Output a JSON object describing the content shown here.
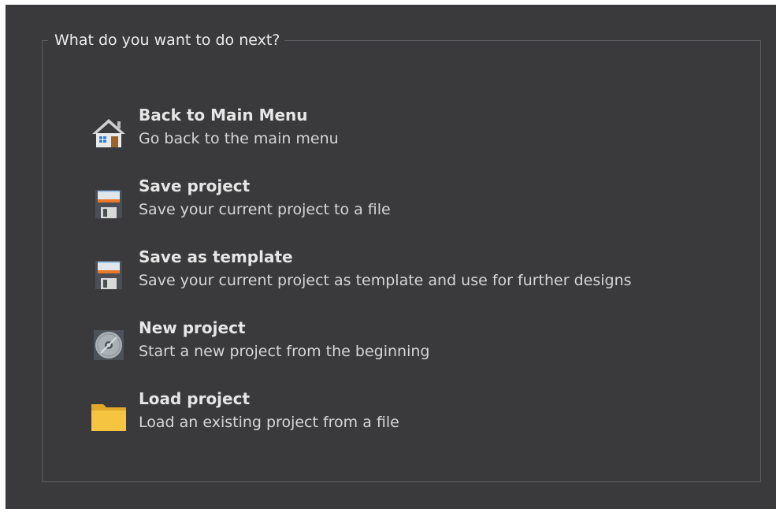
{
  "group": {
    "title": "What do you want to do next?"
  },
  "actions": [
    {
      "icon": "house-icon",
      "title": "Back to Main Menu",
      "description": "Go back to the main menu"
    },
    {
      "icon": "floppy-disk-icon",
      "title": "Save project",
      "description": "Save your current project to a file"
    },
    {
      "icon": "floppy-disk-icon",
      "title": "Save as template",
      "description": "Save your current project as template and use for further designs"
    },
    {
      "icon": "disc-icon",
      "title": "New project",
      "description": "Start a new project from the beginning"
    },
    {
      "icon": "folder-icon",
      "title": "Load project",
      "description": "Load an existing project from a file"
    }
  ],
  "colors": {
    "background": "#3a3a3c",
    "border": "#5e5e62",
    "text": "#e6e6e6",
    "folder": "#f5c542",
    "floppy_label": "#d9d9d9",
    "floppy_stripe": "#e8782a",
    "house_roof": "#c8c8c8"
  }
}
